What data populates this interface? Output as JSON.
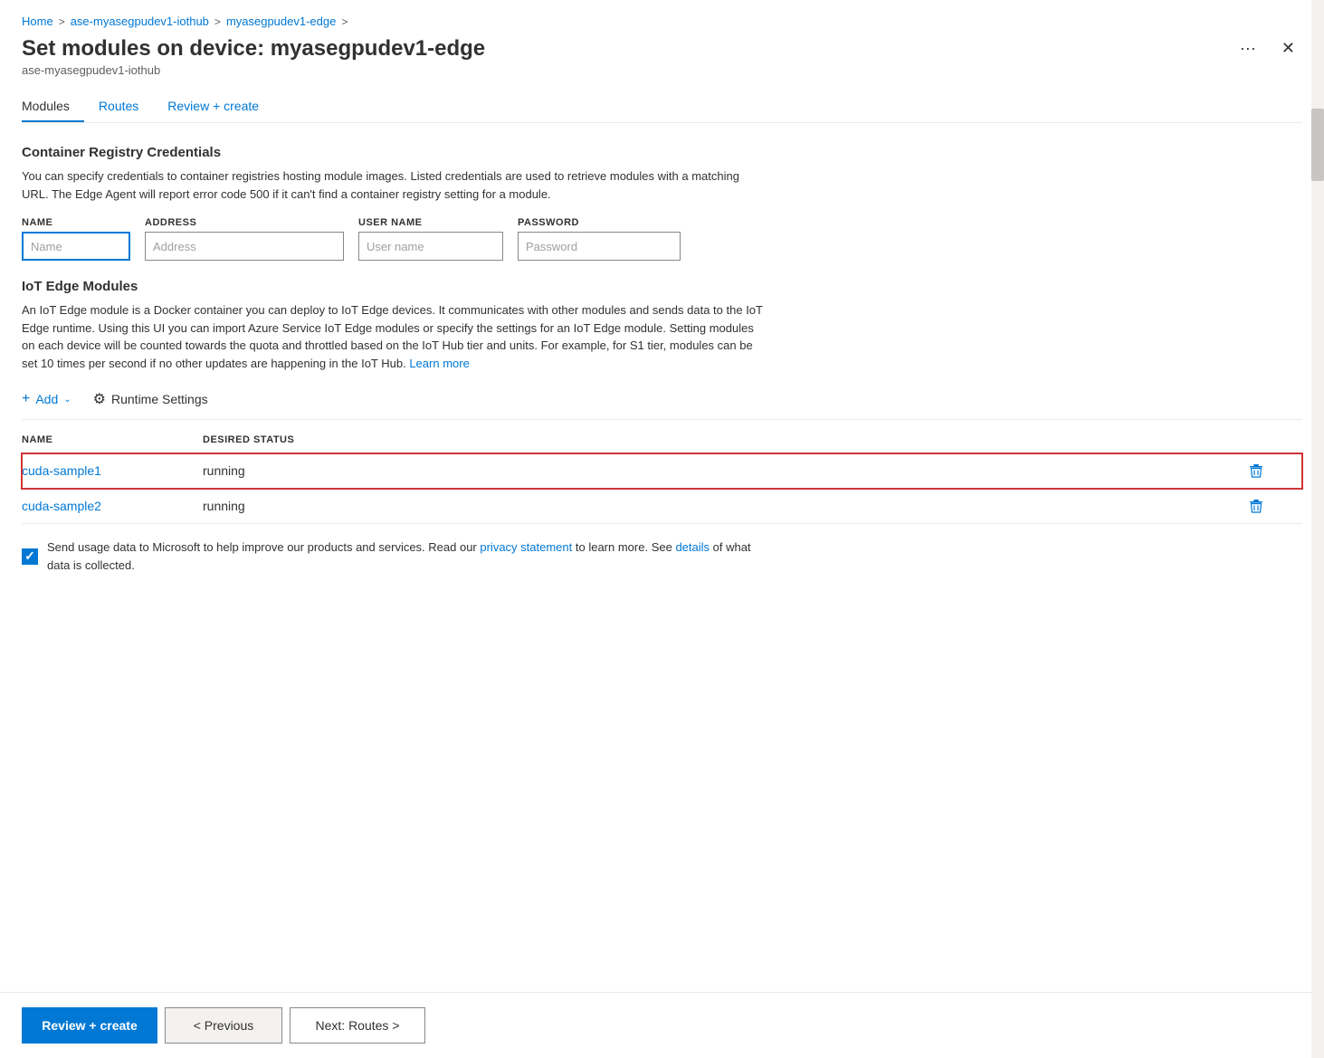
{
  "breadcrumb": {
    "items": [
      "Home",
      "ase-myasegpudev1-iothub",
      "myasegpudev1-edge"
    ],
    "separators": [
      ">",
      ">",
      ">"
    ]
  },
  "header": {
    "title": "Set modules on device: myasegpudev1-edge",
    "subtitle": "ase-myasegpudev1-iothub",
    "ellipsis": "···",
    "close": "✕"
  },
  "tabs": [
    {
      "label": "Modules",
      "active": true
    },
    {
      "label": "Routes",
      "active": false
    },
    {
      "label": "Review + create",
      "active": false
    }
  ],
  "registry": {
    "title": "Container Registry Credentials",
    "description": "You can specify credentials to container registries hosting module images. Listed credentials are used to retrieve modules with a matching URL. The Edge Agent will report error code 500 if it can't find a container registry setting for a module.",
    "fields": {
      "name": {
        "label": "NAME",
        "placeholder": "Name"
      },
      "address": {
        "label": "ADDRESS",
        "placeholder": "Address"
      },
      "username": {
        "label": "USER NAME",
        "placeholder": "User name"
      },
      "password": {
        "label": "PASSWORD",
        "placeholder": "Password"
      }
    }
  },
  "iot_modules": {
    "title": "IoT Edge Modules",
    "description": "An IoT Edge module is a Docker container you can deploy to IoT Edge devices. It communicates with other modules and sends data to the IoT Edge runtime. Using this UI you can import Azure Service IoT Edge modules or specify the settings for an IoT Edge module. Setting modules on each device will be counted towards the quota and throttled based on the IoT Hub tier and units. For example, for S1 tier, modules can be set 10 times per second if no other updates are happening in the IoT Hub.",
    "learn_more_text": "Learn more",
    "add_label": "Add",
    "runtime_label": "Runtime Settings",
    "table": {
      "columns": [
        "NAME",
        "DESIRED STATUS"
      ],
      "rows": [
        {
          "name": "cuda-sample1",
          "status": "running",
          "highlighted": true
        },
        {
          "name": "cuda-sample2",
          "status": "running",
          "highlighted": false
        }
      ]
    }
  },
  "usage": {
    "text_before": "Send usage data to Microsoft to help improve our products and services. Read our ",
    "privacy_link": "privacy statement",
    "text_middle": " to learn more. See ",
    "details_link": "details",
    "text_after": " of what data is collected."
  },
  "footer": {
    "review_create": "Review + create",
    "previous": "< Previous",
    "next": "Next: Routes >"
  }
}
